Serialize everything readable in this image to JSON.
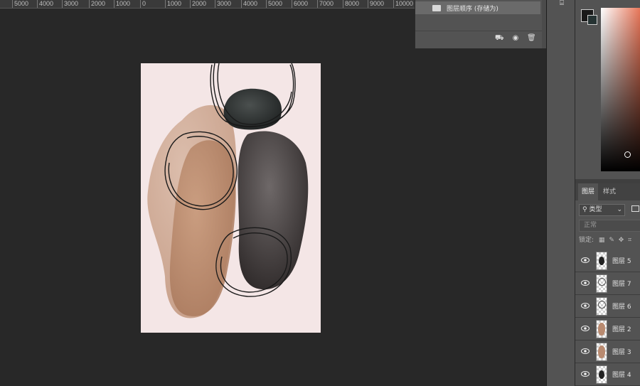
{
  "ruler": {
    "ticks": [
      "5000",
      "4000",
      "3000",
      "2000",
      "1000",
      "0",
      "1000",
      "2000",
      "3000",
      "4000",
      "5000",
      "6000",
      "7000",
      "8000",
      "9000",
      "10000"
    ]
  },
  "actions_panel": {
    "row_label": "图层顺序 (存储为)",
    "buttons": [
      {
        "icon": "new-set-icon",
        "glyph": "⛟"
      },
      {
        "icon": "camera-icon",
        "glyph": "◉"
      },
      {
        "icon": "trash-icon",
        "glyph": "🗑"
      }
    ]
  },
  "colors": {
    "foreground": "#1a1a1a",
    "background": "#263333",
    "picker_hue": "#e8775a",
    "canvas": "#f4e6e6"
  },
  "layers_panel": {
    "tabs": [
      {
        "label": "图层"
      },
      {
        "label": "样式"
      }
    ],
    "filter_label": "类型",
    "blend_mode": "正常",
    "lock_label": "锁定:",
    "layers": [
      {
        "name": "图层 5",
        "thumb": "dark-stone"
      },
      {
        "name": "图层 7",
        "thumb": "circle-lines"
      },
      {
        "name": "图层 6",
        "thumb": "circle-lines"
      },
      {
        "name": "图层 2",
        "thumb": "tan-stone"
      },
      {
        "name": "图层 3",
        "thumb": "tan-stone"
      },
      {
        "name": "图层 4",
        "thumb": "dark-stone"
      }
    ]
  }
}
